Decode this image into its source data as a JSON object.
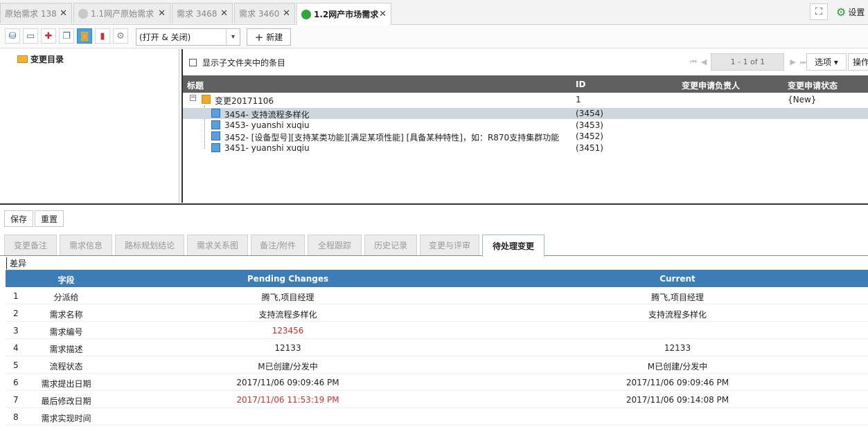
{
  "tabs": [
    {
      "label": "原始需求 138",
      "active": false,
      "icon": "none"
    },
    {
      "label": "1.1网产原始需求",
      "active": false,
      "icon": "grey-circle-icon"
    },
    {
      "label": "需求 3468",
      "active": false,
      "icon": "none"
    },
    {
      "label": "需求 3460",
      "active": false,
      "icon": "none"
    },
    {
      "label": "1.2网产市场需求",
      "active": true,
      "icon": "green-circle-icon"
    }
  ],
  "tab_close_glyph": "✕",
  "header": {
    "expand_glyph": "⛶",
    "settings_label": "设置",
    "gear_glyph": "⚙"
  },
  "toolbar": {
    "icons": [
      "hierarchy-icon",
      "card-icon",
      "split-icon",
      "copy-icon",
      "change-icon",
      "chart-icon",
      "gear-icon"
    ],
    "icon_glyphs": [
      "⛁",
      "▭",
      "✚",
      "❐",
      "◙",
      "▮",
      "⚙"
    ],
    "select_value": "(打开 & 关闭)",
    "caret": "▾",
    "new_label": "新建",
    "new_plus": "+"
  },
  "folder": {
    "label": "变更目录"
  },
  "list": {
    "show_subfolder_label": "显示子文件夹中的条目",
    "pager_first": "⏮",
    "pager_prev": "◀",
    "page_info": "1 - 1 of 1",
    "pager_next": "▶",
    "pager_last": "⏭",
    "options_label": "选项 ▾",
    "actions_label": "操作",
    "columns": [
      "标题",
      "ID",
      "变更申请负责人",
      "变更申请状态"
    ],
    "parent": {
      "title": "变更20171106",
      "id": "1",
      "status": "{New}"
    },
    "children": [
      {
        "title": "3454- 支持流程多样化",
        "id": "(3454)",
        "selected": true
      },
      {
        "title": "3453- yuanshi xuqiu",
        "id": "(3453)",
        "selected": false
      },
      {
        "title": "3452- [设备型号][支持某类功能][满足某项性能] [具备某种特性]，如：R870支持集群功能",
        "id": "(3452)",
        "selected": false
      },
      {
        "title": "3451- yuanshi xuqiu",
        "id": "(3451)",
        "selected": false
      }
    ]
  },
  "form": {
    "save_label": "保存",
    "reset_label": "重置",
    "tabs": [
      "变更备注",
      "需求信息",
      "路标规划结论",
      "需求关系图",
      "备注/附件",
      "全程跟踪",
      "历史记录",
      "变更与评审",
      "待处理变更"
    ],
    "active_tab_index": 8,
    "diff_label": "差异"
  },
  "diff_table": {
    "headers": [
      "字段",
      "Pending Changes",
      "Current"
    ],
    "rows": [
      {
        "num": "1",
        "field": "分派给",
        "pending": "腾飞,项目经理",
        "current": "腾飞,项目经理",
        "pending_changed": false
      },
      {
        "num": "2",
        "field": "需求名称",
        "pending": "支持流程多样化",
        "current": "支持流程多样化",
        "pending_changed": false
      },
      {
        "num": "3",
        "field": "需求编号",
        "pending": "123456",
        "current": "",
        "pending_changed": true
      },
      {
        "num": "4",
        "field": "需求描述",
        "pending": "12133",
        "current": "12133",
        "pending_changed": false
      },
      {
        "num": "5",
        "field": "流程状态",
        "pending": "M已创建/分发中",
        "current": "M已创建/分发中",
        "pending_changed": false
      },
      {
        "num": "6",
        "field": "需求提出日期",
        "pending": "2017/11/06 09:09:46 PM",
        "current": "2017/11/06 09:09:46 PM",
        "pending_changed": false
      },
      {
        "num": "7",
        "field": "最后修改日期",
        "pending": "2017/11/06 11:53:19 PM",
        "current": "2017/11/06 09:14:08 PM",
        "pending_changed": true
      },
      {
        "num": "8",
        "field": "需求实现时间",
        "pending": "",
        "current": "",
        "pending_changed": false
      }
    ]
  },
  "colors": {
    "header_blue": "#3c7db8",
    "changed_red": "#d62b2b",
    "list_header": "#5f5f5f",
    "accent_green": "#2fa83a"
  }
}
